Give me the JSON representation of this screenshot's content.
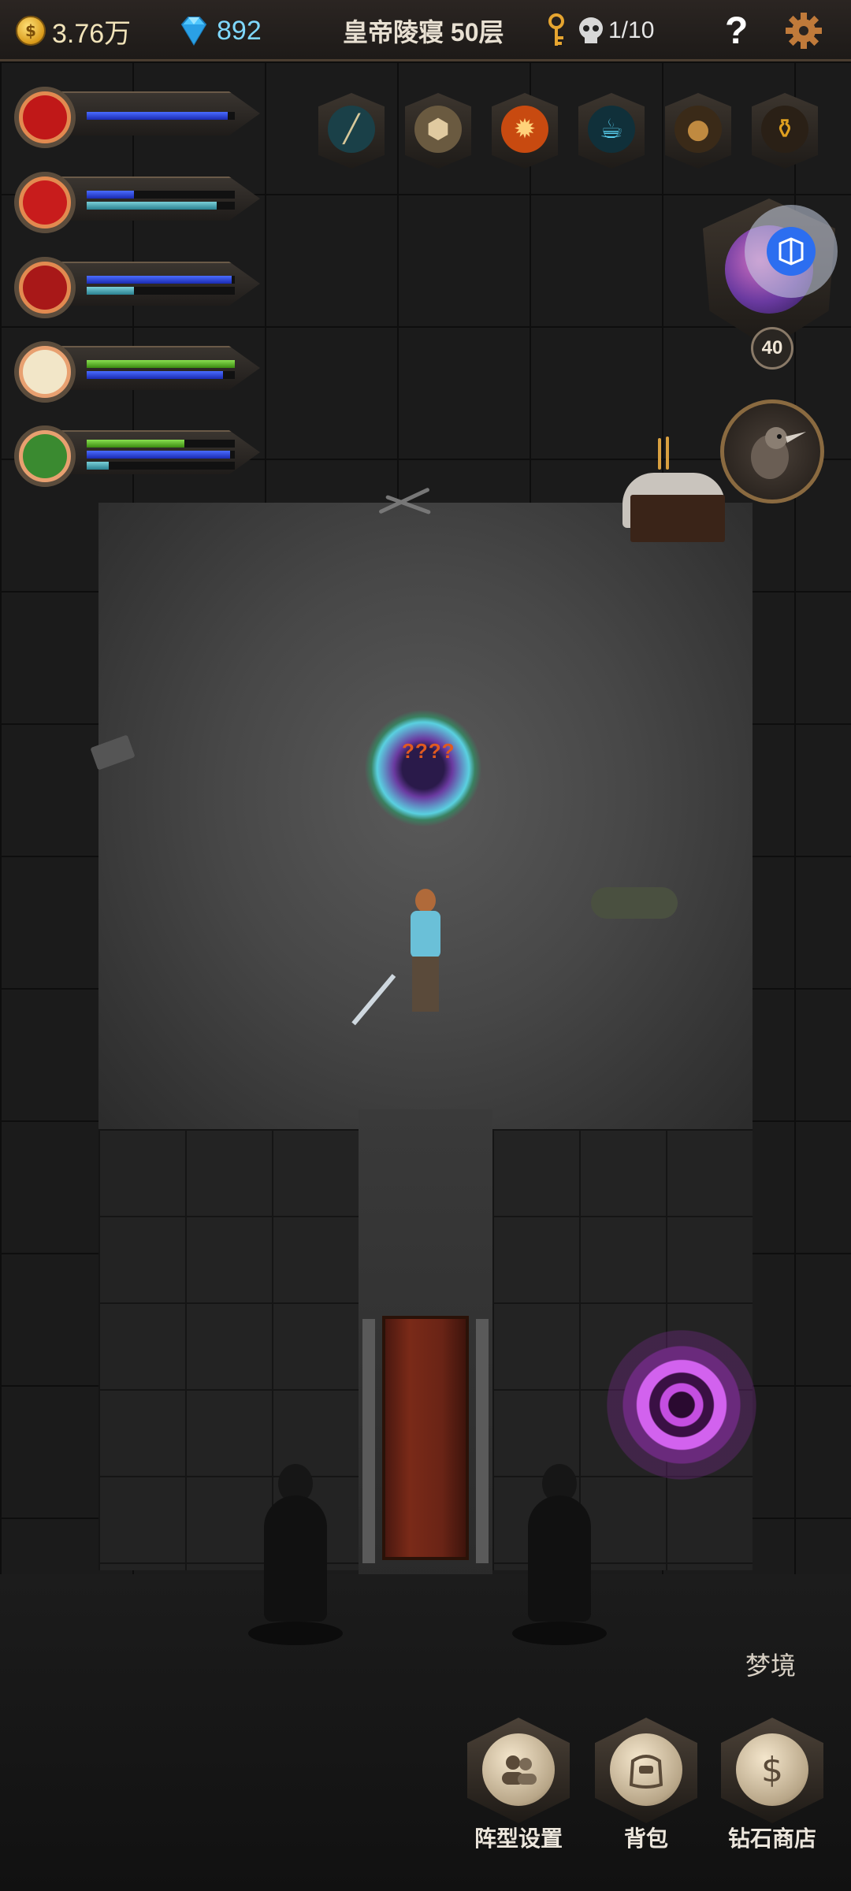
{
  "topbar": {
    "gold": "3.76万",
    "gems": "892",
    "dungeon_title": "皇帝陵寝 50层",
    "kills": "1/10",
    "help_symbol": "?"
  },
  "icons": {
    "gold": "coin-icon",
    "gem": "diamond-icon",
    "key": "key-icon",
    "skull": "skull-icon",
    "help": "question-icon",
    "settings": "gear-icon"
  },
  "party": [
    {
      "portrait": "red-demon",
      "bar1": {
        "color": "blue",
        "fill": 0.95
      },
      "bar2": null
    },
    {
      "portrait": "red-knight",
      "bar1": {
        "color": "blue",
        "fill": 0.32
      },
      "bar2": {
        "color": "teal",
        "fill": 0.88
      }
    },
    {
      "portrait": "red-beast",
      "bar1": {
        "color": "blue",
        "fill": 0.98
      },
      "bar2": {
        "color": "teal",
        "fill": 0.32
      }
    },
    {
      "portrait": "white-hair-girl",
      "bar1": {
        "color": "green",
        "fill": 1.0
      },
      "bar2": {
        "color": "blue",
        "fill": 0.92
      }
    },
    {
      "portrait": "green-archer",
      "bar1": {
        "color": "green",
        "fill": 0.66
      },
      "bar2": {
        "color": "blue",
        "fill": 0.97
      },
      "bar3": {
        "color": "teal",
        "fill": 0.15
      }
    }
  ],
  "items": [
    {
      "icon": "flute-icon",
      "glyph": "╱"
    },
    {
      "icon": "dice-icon",
      "glyph": "⬢"
    },
    {
      "icon": "phoenix-icon",
      "glyph": "✹"
    },
    {
      "icon": "drink-icon",
      "glyph": "☕"
    },
    {
      "icon": "acorn-icon",
      "glyph": "●"
    },
    {
      "icon": "potion-icon",
      "glyph": "⚱"
    }
  ],
  "boss": {
    "level": "40"
  },
  "map": {
    "enemy_label": "????"
  },
  "buttons": {
    "dream": "梦境",
    "formation": "阵型设置",
    "bag": "背包",
    "shop": "钻石商店",
    "shop_glyph": "$"
  },
  "colors": {
    "gold": "#f1e3b9",
    "gem": "#7fd8ff",
    "enemy_label": "#e05a20",
    "portal": "#c44ee0"
  }
}
